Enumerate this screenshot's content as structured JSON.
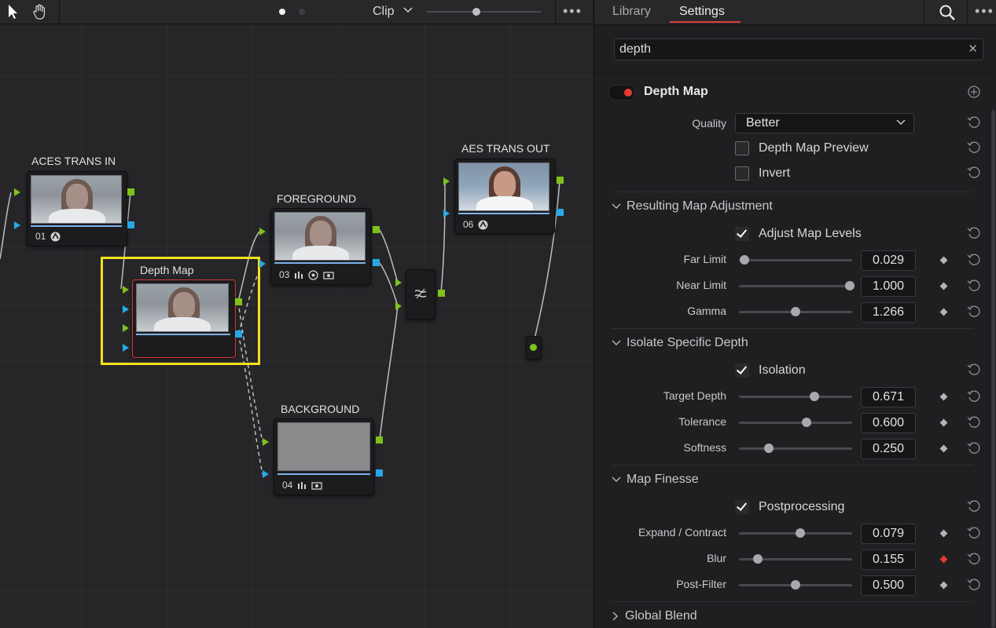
{
  "node_editor": {
    "mode_label": "Clip",
    "zoom_level": 0.44,
    "nodes": {
      "aces_in": {
        "title": "ACES TRANS IN",
        "number": "01"
      },
      "depth_map": {
        "title": "Depth Map"
      },
      "foreground": {
        "title": "FOREGROUND",
        "number": "03"
      },
      "background": {
        "title": "BACKGROUND",
        "number": "04"
      },
      "aes_out": {
        "title": "AES TRANS OUT",
        "number": "06"
      }
    }
  },
  "inspector": {
    "tabs": [
      "Library",
      "Settings"
    ],
    "active_tab": "Settings",
    "search": {
      "value": "depth"
    },
    "effect_title": "Depth Map",
    "enabled": true,
    "quality": {
      "label": "Quality",
      "value": "Better"
    },
    "depth_map_preview": {
      "label": "Depth Map Preview",
      "checked": false
    },
    "invert": {
      "label": "Invert",
      "checked": false
    },
    "sections": {
      "resulting": {
        "title": "Resulting Map Adjustment",
        "checkbox": {
          "label": "Adjust Map Levels",
          "checked": true
        },
        "params": [
          {
            "label": "Far Limit",
            "value": "0.029",
            "fraction": 0.029
          },
          {
            "label": "Near Limit",
            "value": "1.000",
            "fraction": 1.0
          },
          {
            "label": "Gamma",
            "value": "1.266",
            "fraction": 0.5
          }
        ]
      },
      "isolate": {
        "title": "Isolate Specific Depth",
        "checkbox": {
          "label": "Isolation",
          "checked": true
        },
        "params": [
          {
            "label": "Target Depth",
            "value": "0.671",
            "fraction": 0.671
          },
          {
            "label": "Tolerance",
            "value": "0.600",
            "fraction": 0.6
          },
          {
            "label": "Softness",
            "value": "0.250",
            "fraction": 0.25
          }
        ]
      },
      "finesse": {
        "title": "Map Finesse",
        "checkbox": {
          "label": "Postprocessing",
          "checked": true
        },
        "params": [
          {
            "label": "Expand / Contract",
            "value": "0.079",
            "fraction": 0.54
          },
          {
            "label": "Blur",
            "value": "0.155",
            "fraction": 0.155,
            "keyframe_color": "#e33a33"
          },
          {
            "label": "Post-Filter",
            "value": "0.500",
            "fraction": 0.5
          }
        ]
      },
      "global_blend": {
        "title": "Global Blend"
      }
    }
  },
  "colors": {
    "accent_red": "#e33a33",
    "selection_yellow": "#f2e21a",
    "port_green": "#7ec21a",
    "port_blue": "#27a9e6"
  }
}
